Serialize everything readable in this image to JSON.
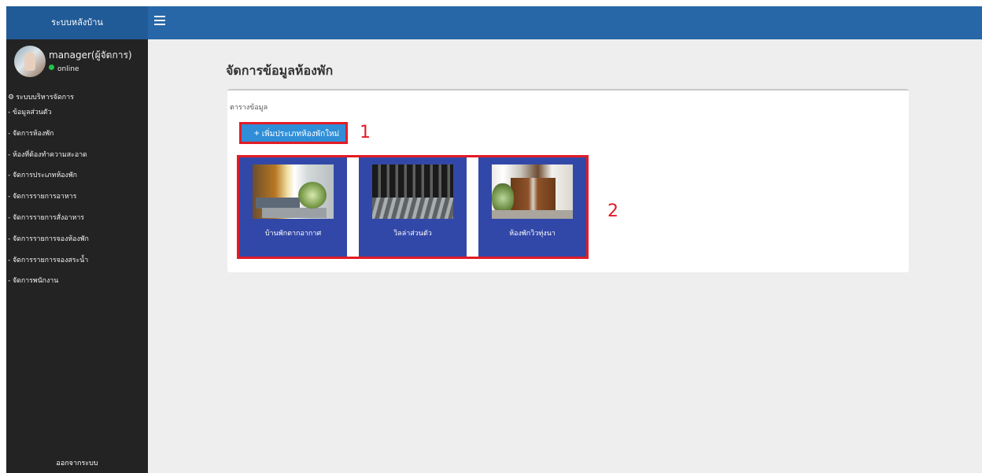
{
  "brand": "ระบบหลังบ้าน",
  "colors": {
    "topbar": "#2767a8",
    "sidebar": "#232323",
    "main_bg": "#eeeeee",
    "button": "#2f8ed7",
    "highlight": "#e21c26",
    "room_card": "#3248a8"
  },
  "icons": {
    "menu": "menu-icon",
    "gear": "gear-icon",
    "plus": "plus-icon",
    "online": "online-status-icon"
  },
  "user": {
    "name": "manager(ผู้จัดการ)",
    "status": "online"
  },
  "sidebar": {
    "section_title": "ระบบบริหารจัดการ",
    "items": [
      "- ข้อมูลส่วนตัว",
      "- จัดการห้องพัก",
      "- ห้องที่ต้องทำความสะอาด",
      "- จัดการประเภทห้องพัก",
      "- จัดการรายการอาหาร",
      "- จัดการรายการสั่งอาหาร",
      "- จัดการรายการจองห้องพัก",
      "- จัดการรายการจองสระน้ำ",
      "- จัดการพนักงาน"
    ],
    "logout": "ออกจากระบบ"
  },
  "page": {
    "title": "จัดการข้อมูลห้องพัก",
    "panel_label": "ตารางข้อมูล",
    "add_button": "เพิ่มประเภทห้องพักใหม่",
    "callouts": [
      "1",
      "2"
    ]
  },
  "rooms": [
    {
      "name": "บ้านพักตากอากาศ"
    },
    {
      "name": "วิลล่าส่วนตัว"
    },
    {
      "name": "ห้องพักวิวทุ่งนา"
    }
  ]
}
